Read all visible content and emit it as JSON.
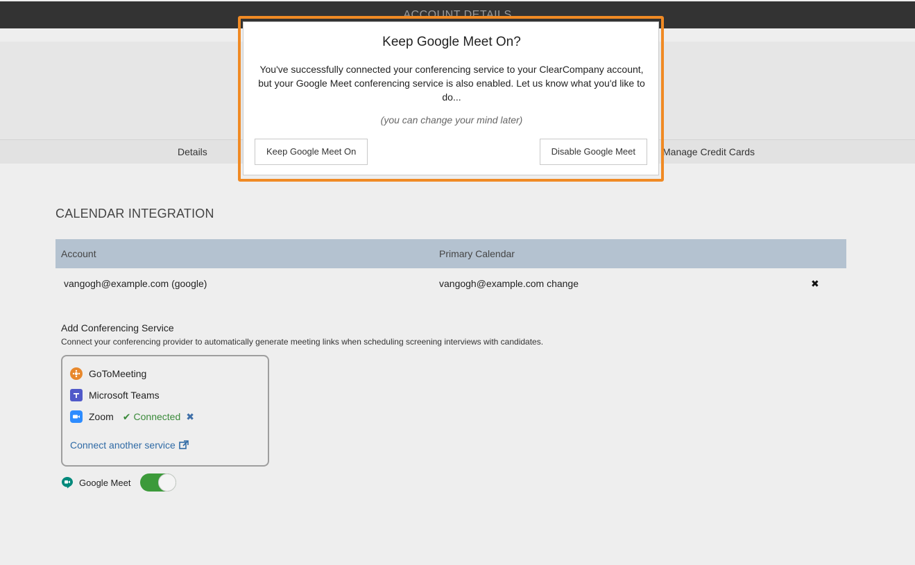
{
  "topbar": {
    "title": "ACCOUNT DETAILS"
  },
  "tabs": [
    {
      "label": "Details"
    },
    {
      "label": "Manage Credit Cards"
    }
  ],
  "calendar": {
    "section_title": "CALENDAR INTEGRATION",
    "columns": [
      "Account",
      "Primary Calendar"
    ],
    "rows": [
      {
        "account": "vangogh@example.com (google)",
        "primary": "vangogh@example.com change",
        "remove": "✖"
      }
    ]
  },
  "conferencing": {
    "title": "Add Conferencing Service",
    "description": "Connect your conferencing provider to automatically generate meeting links when scheduling screening interviews with candidates.",
    "services": [
      {
        "name": "GoToMeeting",
        "icon": "gotomeeting-icon",
        "color": "#e8882c"
      },
      {
        "name": "Microsoft Teams",
        "icon": "teams-icon",
        "color": "#5059c9"
      },
      {
        "name": "Zoom",
        "icon": "zoom-icon",
        "color": "#2d8cff",
        "status": "Connected",
        "remove": "✖"
      }
    ],
    "connect_link": "Connect another service",
    "google_meet": {
      "label": "Google Meet",
      "enabled": true
    }
  },
  "modal": {
    "title": "Keep Google Meet On?",
    "body": "You've successfully connected your conferencing service to your ClearCompany account, but your Google Meet conferencing service is also enabled. Let us know what you'd like to do...",
    "note": "(you can change your mind later)",
    "keep_button": "Keep Google Meet On",
    "disable_button": "Disable Google Meet"
  },
  "colors": {
    "highlight": "#f08a24",
    "table_header": "#b4c2d0",
    "toggle_on": "#3c9a3a",
    "link": "#2f6aa5",
    "connected": "#3a8a3a"
  }
}
